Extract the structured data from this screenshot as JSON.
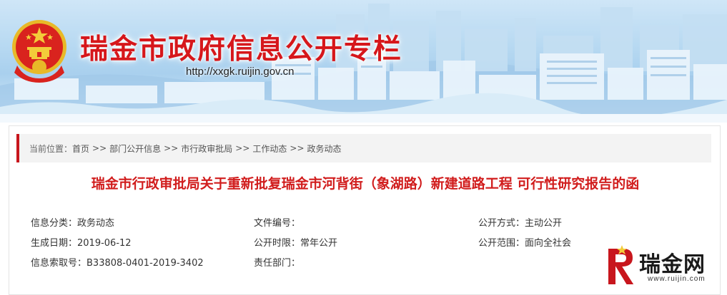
{
  "banner": {
    "title": "瑞金市政府信息公开专栏",
    "url": "http://xxgk.ruijin.gov.cn"
  },
  "breadcrumb": {
    "prefix": "当前位置：",
    "items": [
      "首页",
      "部门公开信息",
      "市行政审批局",
      "工作动态",
      "政务动态"
    ],
    "separator": ">>"
  },
  "document": {
    "title": "瑞金市行政审批局关于重新批复瑞金市河背街（象湖路）新建道路工程 可行性研究报告的函"
  },
  "meta": [
    {
      "label": "信息分类：",
      "value": "政务动态"
    },
    {
      "label": "文件编号：",
      "value": ""
    },
    {
      "label": "公开方式：",
      "value": "主动公开"
    },
    {
      "label": "生成日期：",
      "value": "2019-06-12"
    },
    {
      "label": "公开时限：",
      "value": "常年公开"
    },
    {
      "label": "公开范围：",
      "value": "面向全社会"
    },
    {
      "label": "信息索取号：",
      "value": "B33808-0401-2019-3402"
    },
    {
      "label": "责任部门：",
      "value": ""
    },
    {
      "label": "",
      "value": ""
    }
  ],
  "watermark": {
    "text": "瑞金网",
    "sub": "www.ruijin.com"
  },
  "colors": {
    "title_red": "#d6171b",
    "accent_red": "#c8161d",
    "doc_title_red": "#d11d1d"
  }
}
